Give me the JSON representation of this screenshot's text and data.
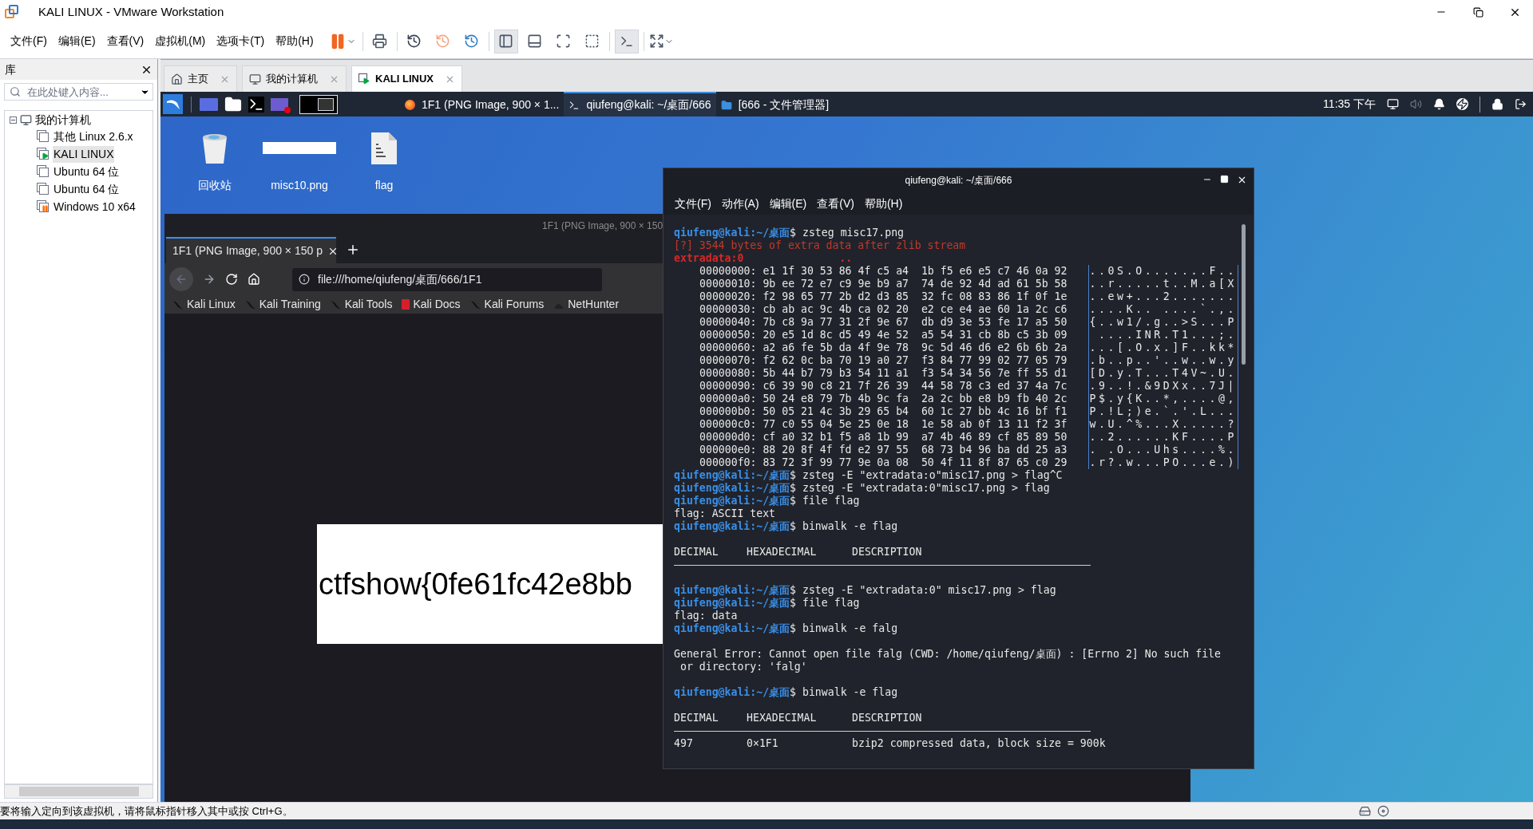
{
  "window": {
    "title": "KALI LINUX - VMware Workstation"
  },
  "menu": [
    "文件(F)",
    "编辑(E)",
    "查看(V)",
    "虚拟机(M)",
    "选项卡(T)",
    "帮助(H)"
  ],
  "library": {
    "title": "库",
    "search": {
      "placeholder": "在此处键入内容..."
    },
    "tree": [
      {
        "label": "我的计算机",
        "expanded": true,
        "children": [
          {
            "label": "其他 Linux 2.6.x",
            "kind": "off",
            "selected": false
          },
          {
            "label": "KALI LINUX",
            "kind": "running",
            "selected": true
          },
          {
            "label": "Ubuntu 64 位",
            "kind": "off",
            "selected": false
          },
          {
            "label": "Ubuntu 64 位",
            "kind": "off",
            "selected": false
          },
          {
            "label": "Windows 10 x64",
            "kind": "paused",
            "selected": false
          }
        ]
      }
    ]
  },
  "vm_tabs": [
    {
      "label": "主页",
      "kind": "home",
      "selected": false
    },
    {
      "label": "我的计算机",
      "kind": "computer",
      "selected": false
    },
    {
      "label": "KALI LINUX",
      "kind": "vm",
      "selected": true
    }
  ],
  "guest": {
    "panel": {
      "tasks": [
        {
          "label": "1F1 (PNG Image, 900 × 1...",
          "kind": "firefox",
          "selected": false
        },
        {
          "label": "qiufeng@kali: ~/桌面/666",
          "kind": "terminal",
          "selected": true
        },
        {
          "label": "[666 - 文件管理器]",
          "kind": "folder",
          "selected": false
        }
      ],
      "clock": "11:35 下午"
    },
    "desktop_icons": [
      {
        "label": "回收站",
        "kind": "trash"
      },
      {
        "label": "misc10.png",
        "kind": "image"
      },
      {
        "label": "flag",
        "kind": "binary"
      }
    ],
    "browser": {
      "window_title": "1F1 (PNG Image, 900 × 150",
      "tab": "1F1 (PNG Image, 900 × 150 p",
      "url": "file:///home/qiufeng/桌面/666/1F1",
      "bookmarks": [
        {
          "label": "Kali Linux",
          "kind": "kali"
        },
        {
          "label": "Kali Training",
          "kind": "kali"
        },
        {
          "label": "Kali Tools",
          "kind": "kali"
        },
        {
          "label": "Kali Docs",
          "kind": "docs"
        },
        {
          "label": "Kali Forums",
          "kind": "kali"
        },
        {
          "label": "NetHunter",
          "kind": "nethunter"
        }
      ],
      "image_text": "ctfshow{0fe61fc42e8bb"
    },
    "terminal": {
      "title": "qiufeng@kali: ~/桌面/666",
      "menu": [
        "文件(F)",
        "动作(A)",
        "编辑(E)",
        "查看(V)",
        "帮助(H)"
      ],
      "lines": [
        {
          "kind": "prompt",
          "user": "qiufeng@kali",
          "path": ":~/桌面",
          "command": "$ zsteg misc17.png"
        },
        {
          "kind": "error",
          "text": "[?] 3544 bytes of extra data after zlib stream"
        },
        {
          "kind": "label",
          "text": "extradata:0",
          "mark": ".."
        },
        {
          "kind": "hex",
          "bytes": "00000000: e1 1f 30 53 86 4f c5 a4  1b f5 e6 e5 c7 46 0a 92",
          "ascii": "..0S.O.......F.."
        },
        {
          "kind": "hex",
          "bytes": "00000010: 9b ee 72 e7 c9 9e b9 a7  74 de 92 4d ad 61 5b 58",
          "ascii": "..r.....t..M.a[X"
        },
        {
          "kind": "hex",
          "bytes": "00000020: f2 98 65 77 2b d2 d3 85  32 fc 08 83 86 1f 0f 1e",
          "ascii": "..ew+...2......."
        },
        {
          "kind": "hex",
          "bytes": "00000030: cb ab ac 9c 4b ca 02 20  e2 ce e4 ae 60 1a 2c c6",
          "ascii": "....K.. ....`.,."
        },
        {
          "kind": "hex",
          "bytes": "00000040: 7b c8 9a 77 31 2f 9e 67  db d9 3e 53 fe 17 a5 50",
          "ascii": "{..w1/.g..>S...P"
        },
        {
          "kind": "hex",
          "bytes": "00000050: 20 e5 1d 8c d5 49 4e 52  a5 54 31 cb 8b c5 3b 09",
          "ascii": " ....INR.T1...;."
        },
        {
          "kind": "hex",
          "bytes": "00000060: a2 a6 fe 5b da 4f 9e 78  9c 5d 46 d6 e2 6b 6b 2a",
          "ascii": "...[.O.x.]F..kk*"
        },
        {
          "kind": "hex",
          "bytes": "00000070: f2 62 0c ba 70 19 a0 27  f3 84 77 99 02 77 05 79",
          "ascii": ".b..p..'..w..w.y"
        },
        {
          "kind": "hex",
          "bytes": "00000080: 5b 44 b7 79 b3 54 11 a1  f3 54 34 56 7e ff 55 d1",
          "ascii": "[D.y.T...T4V~.U."
        },
        {
          "kind": "hex",
          "bytes": "00000090: c6 39 90 c8 21 7f 26 39  44 58 78 c3 ed 37 4a 7c",
          "ascii": ".9..!.&9DXx..7J|"
        },
        {
          "kind": "hex",
          "bytes": "000000a0: 50 24 e8 79 7b 4b 9c fa  2a 2c bb e8 b9 fb 40 2c",
          "ascii": "P$.y{K..*,....@,"
        },
        {
          "kind": "hex",
          "bytes": "000000b0: 50 05 21 4c 3b 29 65 b4  60 1c 27 bb 4c 16 bf f1",
          "ascii": "P.!L;)e.`.'.L..."
        },
        {
          "kind": "hex",
          "bytes": "000000c0: 77 c0 55 04 5e 25 0e 18  1e 58 ab 0f 13 11 f2 3f",
          "ascii": "w.U.^%...X.....?"
        },
        {
          "kind": "hex",
          "bytes": "000000d0: cf a0 32 b1 f5 a8 1b 99  a7 4b 46 89 cf 85 89 50",
          "ascii": "..2......KF....P"
        },
        {
          "kind": "hex",
          "bytes": "000000e0: 88 20 8f 4f fd e2 97 55  68 73 b4 96 ba dd 25 a3",
          "ascii": ". .O...Uhs....%."
        },
        {
          "kind": "hex",
          "bytes": "000000f0: 83 72 3f 99 77 9e 0a 08  50 4f 11 8f 87 65 c0 29",
          "ascii": ".r?.w...PO...e.)"
        },
        {
          "kind": "prompt",
          "user": "qiufeng@kali",
          "path": ":~/桌面",
          "command": "$ zsteg -E \"extradata:o\"misc17.png > flag^C"
        },
        {
          "kind": "prompt",
          "user": "qiufeng@kali",
          "path": ":~/桌面",
          "command": "$ zsteg -E \"extradata:0\"misc17.png > flag"
        },
        {
          "kind": "prompt",
          "user": "qiufeng@kali",
          "path": ":~/桌面",
          "command": "$ file flag"
        },
        {
          "kind": "output",
          "text": "flag: ASCII text"
        },
        {
          "kind": "prompt",
          "user": "qiufeng@kali",
          "path": ":~/桌面",
          "command": "$ binwalk -e flag"
        },
        {
          "kind": "blank"
        },
        {
          "kind": "table",
          "cells": [
            "DECIMAL",
            "HEXADECIMAL",
            "DESCRIPTION"
          ]
        },
        {
          "kind": "rule"
        },
        {
          "kind": "blank"
        },
        {
          "kind": "prompt",
          "user": "qiufeng@kali",
          "path": ":~/桌面",
          "command": "$ zsteg -E \"extradata:0\" misc17.png > flag"
        },
        {
          "kind": "prompt",
          "user": "qiufeng@kali",
          "path": ":~/桌面",
          "command": "$ file flag"
        },
        {
          "kind": "output",
          "text": "flag: data"
        },
        {
          "kind": "prompt",
          "user": "qiufeng@kali",
          "path": ":~/桌面",
          "command": "$ binwalk -e falg"
        },
        {
          "kind": "blank"
        },
        {
          "kind": "output",
          "text": "General Error: Cannot open file falg (CWD: /home/qiufeng/桌面) : [Errno 2] No such file"
        },
        {
          "kind": "output",
          "text": " or directory: 'falg'"
        },
        {
          "kind": "blank"
        },
        {
          "kind": "prompt",
          "user": "qiufeng@kali",
          "path": ":~/桌面",
          "command": "$ binwalk -e flag"
        },
        {
          "kind": "blank"
        },
        {
          "kind": "table",
          "cells": [
            "DECIMAL",
            "HEXADECIMAL",
            "DESCRIPTION"
          ]
        },
        {
          "kind": "rule"
        },
        {
          "kind": "table",
          "cells": [
            "497",
            "0×1F1",
            "bzip2 compressed data, block size = 900k"
          ]
        }
      ]
    }
  },
  "status_bar": "要将输入定向到该虚拟机，请将鼠标指针移入其中或按 Ctrl+G。"
}
